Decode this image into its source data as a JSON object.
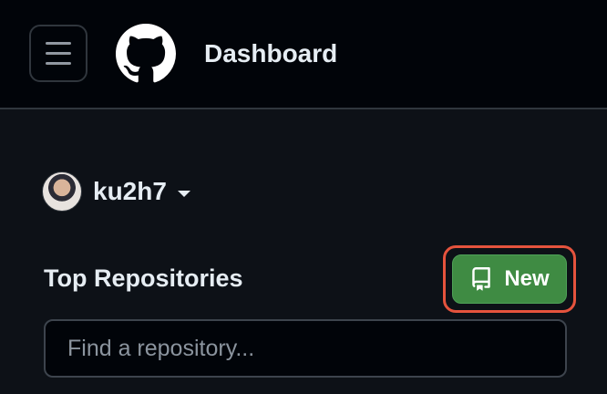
{
  "header": {
    "title": "Dashboard",
    "menu_icon": "hamburger-menu-icon",
    "logo_icon": "github-octocat-icon"
  },
  "user": {
    "name": "ku2h7",
    "caret_icon": "triangle-down-icon"
  },
  "repositories": {
    "title": "Top Repositories",
    "new_button_label": "New",
    "new_button_icon": "repo-icon",
    "search_placeholder": "Find a repository..."
  },
  "colors": {
    "background": "#0d1117",
    "header_background": "#010409",
    "new_button": "#3f8b43",
    "highlight": "#e5533d"
  }
}
